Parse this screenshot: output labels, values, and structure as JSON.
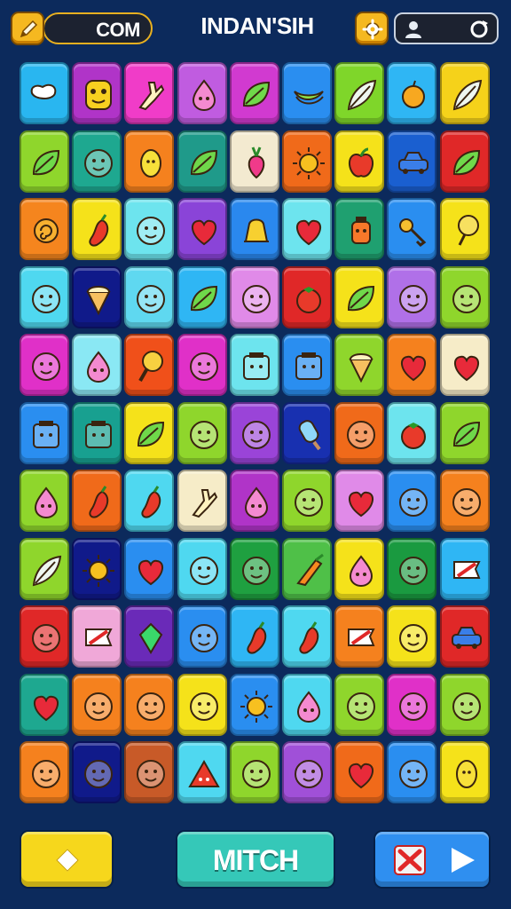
{
  "header": {
    "left_label": "COM",
    "title": "INDAN'SIH",
    "pencil_icon": "pencil-icon",
    "settings_icon": "gear-icon",
    "profile_icon": "person-icon",
    "refresh_icon": "refresh-icon"
  },
  "board": {
    "columns": 9,
    "rows": 11,
    "tiles": [
      {
        "color": "#29b6f0",
        "icon": "blob"
      },
      {
        "color": "#b034c8",
        "icon": "mask"
      },
      {
        "color": "#f03cc8",
        "icon": "hand"
      },
      {
        "color": "#c05ce0",
        "icon": "drop"
      },
      {
        "color": "#d13ad0",
        "icon": "leaf"
      },
      {
        "color": "#2a8ef0",
        "icon": "banana"
      },
      {
        "color": "#7fd62a",
        "icon": "feather"
      },
      {
        "color": "#2fb6f4",
        "icon": "fruit"
      },
      {
        "color": "#f5d21a",
        "icon": "feather"
      },
      {
        "color": "#8fd62c",
        "icon": "leaf"
      },
      {
        "color": "#1ea890",
        "icon": "face"
      },
      {
        "color": "#f5811e",
        "icon": "lemon"
      },
      {
        "color": "#1f9a8a",
        "icon": "leaf"
      },
      {
        "color": "#f3ead0",
        "icon": "radish"
      },
      {
        "color": "#f06a1a",
        "icon": "sun"
      },
      {
        "color": "#f5e21a",
        "icon": "apple"
      },
      {
        "color": "#1a5fd0",
        "icon": "car"
      },
      {
        "color": "#e02828",
        "icon": "leaf"
      },
      {
        "color": "#f5851e",
        "icon": "swirl"
      },
      {
        "color": "#f5e21a",
        "icon": "pepper"
      },
      {
        "color": "#6de4ee",
        "icon": "face"
      },
      {
        "color": "#8a44d8",
        "icon": "heart"
      },
      {
        "color": "#2a88ee",
        "icon": "bell"
      },
      {
        "color": "#6de4ee",
        "icon": "heart"
      },
      {
        "color": "#1fa070",
        "icon": "jar"
      },
      {
        "color": "#2a8ef0",
        "icon": "key"
      },
      {
        "color": "#f5e21a",
        "icon": "tree"
      },
      {
        "color": "#4fd8f0",
        "icon": "face"
      },
      {
        "color": "#101a8a",
        "icon": "cone"
      },
      {
        "color": "#5fd8f0",
        "icon": "face"
      },
      {
        "color": "#2fb6f4",
        "icon": "leaf"
      },
      {
        "color": "#e08ae8",
        "icon": "face"
      },
      {
        "color": "#e02828",
        "icon": "tomato"
      },
      {
        "color": "#f5e21a",
        "icon": "leaf"
      },
      {
        "color": "#b070e8",
        "icon": "face"
      },
      {
        "color": "#8fd62c",
        "icon": "face"
      },
      {
        "color": "#e030c8",
        "icon": "face"
      },
      {
        "color": "#8ae8f4",
        "icon": "drop"
      },
      {
        "color": "#f0501a",
        "icon": "bulb"
      },
      {
        "color": "#e030c8",
        "icon": "face"
      },
      {
        "color": "#6de4ee",
        "icon": "box"
      },
      {
        "color": "#2a8ef0",
        "icon": "box"
      },
      {
        "color": "#8fd62c",
        "icon": "cone"
      },
      {
        "color": "#f5811e",
        "icon": "heart"
      },
      {
        "color": "#f6ecc8",
        "icon": "heart"
      },
      {
        "color": "#2a8ef0",
        "icon": "box"
      },
      {
        "color": "#18a090",
        "icon": "box"
      },
      {
        "color": "#f5e21a",
        "icon": "leaf"
      },
      {
        "color": "#8fd62c",
        "icon": "face"
      },
      {
        "color": "#9a44d8",
        "icon": "face"
      },
      {
        "color": "#1830b0",
        "icon": "popsicle"
      },
      {
        "color": "#f06a1a",
        "icon": "face"
      },
      {
        "color": "#6de4ee",
        "icon": "tomato"
      },
      {
        "color": "#8fd62c",
        "icon": "leaf"
      },
      {
        "color": "#8fd62c",
        "icon": "drop"
      },
      {
        "color": "#f06a1a",
        "icon": "pepper"
      },
      {
        "color": "#4fd8f0",
        "icon": "pepper"
      },
      {
        "color": "#f6ecc8",
        "icon": "hand"
      },
      {
        "color": "#b034c8",
        "icon": "drop"
      },
      {
        "color": "#8fd62c",
        "icon": "face"
      },
      {
        "color": "#e08ae8",
        "icon": "heart"
      },
      {
        "color": "#2a8ef0",
        "icon": "face"
      },
      {
        "color": "#f5811e",
        "icon": "face"
      },
      {
        "color": "#8fd62c",
        "icon": "feather"
      },
      {
        "color": "#101a8a",
        "icon": "sun"
      },
      {
        "color": "#2a8ef0",
        "icon": "heart"
      },
      {
        "color": "#4fd8f0",
        "icon": "face"
      },
      {
        "color": "#1fa040",
        "icon": "face"
      },
      {
        "color": "#4fc048",
        "icon": "carrot"
      },
      {
        "color": "#f5e21a",
        "icon": "drop"
      },
      {
        "color": "#1a9a40",
        "icon": "face"
      },
      {
        "color": "#2fb6f4",
        "icon": "flag"
      },
      {
        "color": "#e02828",
        "icon": "face"
      },
      {
        "color": "#f0a8d8",
        "icon": "flag"
      },
      {
        "color": "#6a2ab8",
        "icon": "gem"
      },
      {
        "color": "#2a8ef0",
        "icon": "face"
      },
      {
        "color": "#2fb6f4",
        "icon": "pepper"
      },
      {
        "color": "#4fd8f0",
        "icon": "pepper"
      },
      {
        "color": "#f5811e",
        "icon": "flag"
      },
      {
        "color": "#f5e21a",
        "icon": "face"
      },
      {
        "color": "#e02828",
        "icon": "car"
      },
      {
        "color": "#1ea890",
        "icon": "heart"
      },
      {
        "color": "#f5811e",
        "icon": "face"
      },
      {
        "color": "#f5811e",
        "icon": "face"
      },
      {
        "color": "#f5e21a",
        "icon": "face"
      },
      {
        "color": "#2a8ef0",
        "icon": "sun"
      },
      {
        "color": "#4fd8f0",
        "icon": "drop"
      },
      {
        "color": "#8fd62c",
        "icon": "face"
      },
      {
        "color": "#e030c8",
        "icon": "face"
      },
      {
        "color": "#8fd62c",
        "icon": "face"
      },
      {
        "color": "#f5811e",
        "icon": "face"
      },
      {
        "color": "#101a8a",
        "icon": "face"
      },
      {
        "color": "#c85a28",
        "icon": "face"
      },
      {
        "color": "#4fd8f0",
        "icon": "triangle"
      },
      {
        "color": "#8fd62c",
        "icon": "face"
      },
      {
        "color": "#a050d8",
        "icon": "face"
      },
      {
        "color": "#f06a1a",
        "icon": "heart"
      },
      {
        "color": "#2a8ef0",
        "icon": "face"
      },
      {
        "color": "#f5e21a",
        "icon": "lemon"
      }
    ]
  },
  "footer": {
    "left_icon": "diamond-icon",
    "match_label": "MITCH",
    "cancel_icon": "close-icon",
    "play_icon": "play-icon"
  },
  "colors": {
    "background": "#0c2a5c",
    "accent": "#f5b820"
  }
}
